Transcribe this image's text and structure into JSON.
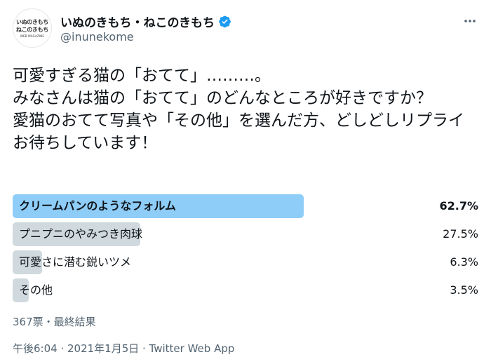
{
  "account": {
    "display_name": "いぬのきもち・ねこのきもち",
    "handle": "@inunekome",
    "avatar_line1": "いぬのきもち",
    "avatar_line2": "ねこのきもち",
    "avatar_line3": "WEB MAGAZINE",
    "verified_color": "#1d9bf0"
  },
  "tweet": {
    "text": "可愛すぎる猫の「おてて」………。\nみなさんは猫の「おてて」のどんなところが好きですか？\n愛猫のおてて写真や「その他」を選んだ方、どしどしリプライお待ちしています！"
  },
  "poll": {
    "options": [
      {
        "label": "クリームパンのようなフォルム",
        "percent": "62.7%",
        "value": 62.7,
        "winner": true
      },
      {
        "label": "プニプニのやみつき肉球",
        "percent": "27.5%",
        "value": 27.5,
        "winner": false
      },
      {
        "label": "可愛さに潜む鋭いツメ",
        "percent": "6.3%",
        "value": 6.3,
        "winner": false
      },
      {
        "label": "その他",
        "percent": "3.5%",
        "value": 3.5,
        "winner": false
      }
    ],
    "summary": "367票・最終結果",
    "winner_color": "#8ecdf8",
    "bar_color": "#cfd9de"
  },
  "timestamp": "午後6:04 · 2021年1月5日 · Twitter Web App",
  "icons": {
    "more": "more-horizontal-icon",
    "verified": "verified-badge-icon"
  }
}
